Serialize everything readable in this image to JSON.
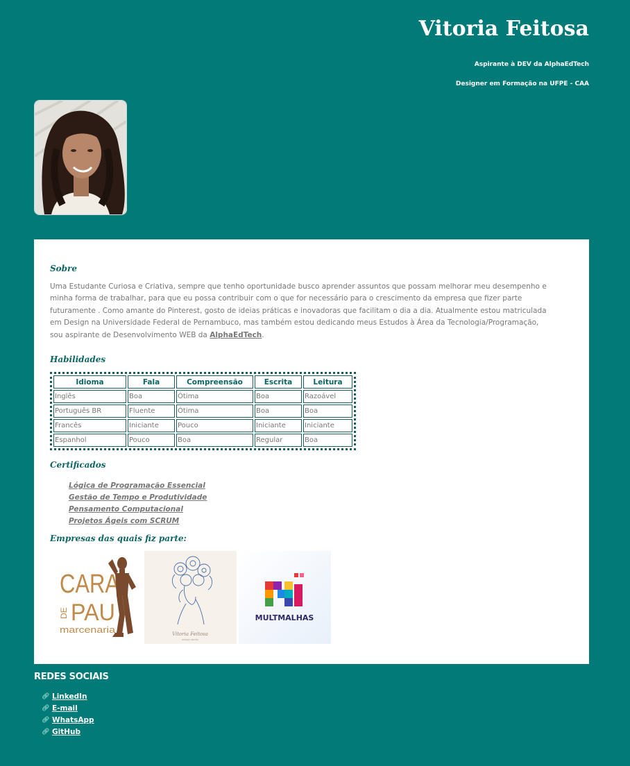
{
  "header": {
    "name": "Vitoria Feitosa",
    "subtitle1": "Aspirante à DEV da AlphaEdTech",
    "subtitle2": "Designer em Formação na UFPE - CAA"
  },
  "about": {
    "title": "Sobre",
    "text": "Uma Estudante Curiosa e Criativa, sempre que tenho oportunidade busco aprender assuntos que possam melhorar meu desempenho e minha forma de trabalhar, para que eu possa contribuir com o que for necessário para o crescimento da empresa que fizer parte futuramente . Como amante do Pinterest, gosto de ideias práticas e inovadoras que facilitam o dia a dia. Atualmente estou matriculada em Design na Universidade Federal de Pernambuco, mas também estou dedicando meus Estudos à Área da Tecnologia/Programação, sou aspirante de Desenvolvimento WEB da ",
    "link": "AlphaEdTech",
    "suffix": "."
  },
  "skills": {
    "title": "Habilidades",
    "headers": [
      "Idioma",
      "Fala",
      "Compreensão",
      "Escrita",
      "Leitura"
    ],
    "rows": [
      [
        "Inglês",
        "Boa",
        "Ótima",
        "Boa",
        "Razoável"
      ],
      [
        "Português BR",
        "Fluente",
        "Ótima",
        "Boa",
        "Boa"
      ],
      [
        "Francês",
        "Iniciante",
        "Pouco",
        "Iniciante",
        "Iniciante"
      ],
      [
        "Espanhol",
        "Pouco",
        "Boa",
        "Regular",
        "Boa"
      ]
    ]
  },
  "certificates": {
    "title": "Certificados",
    "items": [
      "Lógica de Programação Essencial",
      "Gestão de Tempo e Produtividade",
      "Pensamento Computacional",
      "Projetos Ágeis com SCRUM"
    ]
  },
  "companies": {
    "title": "Empresas das quais fiz parte:",
    "logo1": {
      "line1": "CARA",
      "line2a": "DE",
      "line2b": "PAU",
      "line3": "marcenaria"
    },
    "logo2": {
      "signature": "Vitoria Feitosa",
      "tagline": "design studio"
    },
    "logo3": {
      "text": "MULTMALHAS"
    }
  },
  "social": {
    "title": "REDES SOCIAIS",
    "items": [
      "LinkedIn",
      "E-mail",
      "WhatsApp",
      "GitHub"
    ],
    "icon": "link-icon"
  },
  "colors": {
    "background": "#017a78",
    "accent": "#0d6664",
    "text": "#777777",
    "wood": "#c08a4a",
    "brown": "#7a4a2e"
  }
}
